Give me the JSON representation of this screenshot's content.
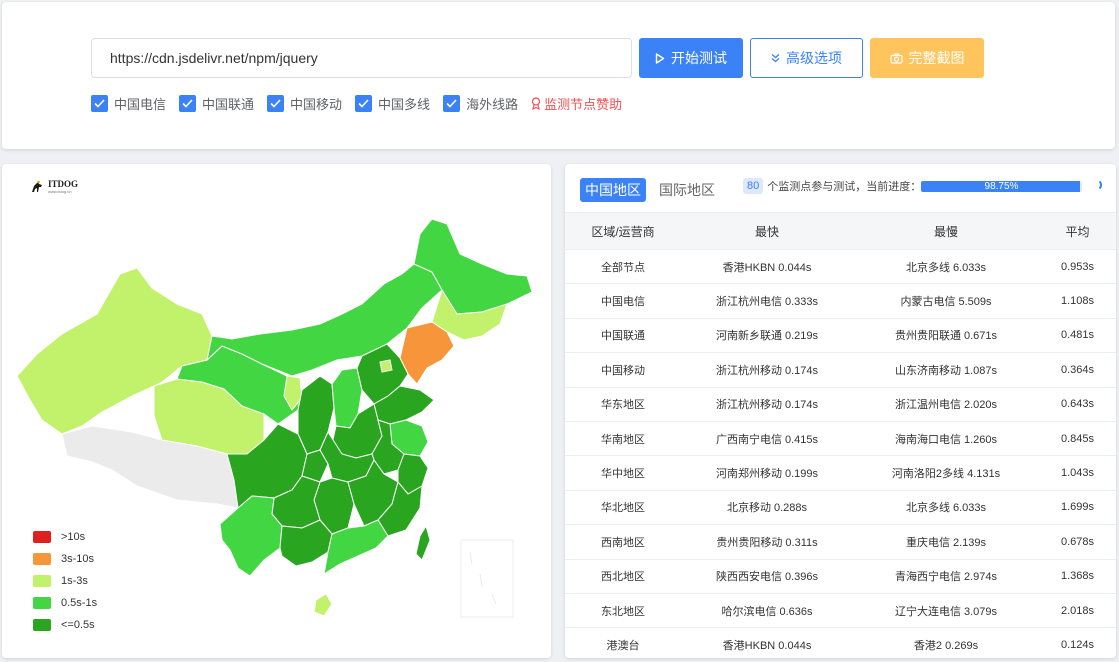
{
  "toolbar": {
    "url_value": "https://cdn.jsdelivr.net/npm/jquery",
    "start_label": "开始测试",
    "advanced_label": "高级选项",
    "screenshot_label": "完整截图"
  },
  "filters": [
    {
      "label": "中国电信",
      "checked": true
    },
    {
      "label": "中国联通",
      "checked": true
    },
    {
      "label": "中国移动",
      "checked": true
    },
    {
      "label": "中国多线",
      "checked": true
    },
    {
      "label": "海外线路",
      "checked": true
    }
  ],
  "sponsor_label": "监测节点赞助",
  "map": {
    "logo_text": "ITDOG",
    "logo_sub": "www.itdog.cn",
    "legend": [
      {
        "label": ">10s",
        "color": "#e02020"
      },
      {
        "label": "3s-10s",
        "color": "#f7953a"
      },
      {
        "label": "1s-3s",
        "color": "#c2f26b"
      },
      {
        "label": "0.5s-1s",
        "color": "#43d643"
      },
      {
        "label": "<=0.5s",
        "color": "#2aa520"
      }
    ]
  },
  "tabs": [
    {
      "label": "中国地区",
      "active": true
    },
    {
      "label": "国际地区",
      "active": false
    }
  ],
  "progress": {
    "count": "80",
    "text": "个监测点参与测试，当前进度：",
    "percent_label": "98.75%",
    "percent": 98.75
  },
  "table": {
    "headers": [
      "区域/运营商",
      "最快",
      "最慢",
      "平均"
    ],
    "rows": [
      [
        "全部节点",
        "香港HKBN 0.044s",
        "北京多线 6.033s",
        "0.953s"
      ],
      [
        "中国电信",
        "浙江杭州电信 0.333s",
        "内蒙古电信 5.509s",
        "1.108s"
      ],
      [
        "中国联通",
        "河南新乡联通 0.219s",
        "贵州贵阳联通 0.671s",
        "0.481s"
      ],
      [
        "中国移动",
        "浙江杭州移动 0.174s",
        "山东济南移动 1.087s",
        "0.364s"
      ],
      [
        "华东地区",
        "浙江杭州移动 0.174s",
        "浙江温州电信 2.020s",
        "0.643s"
      ],
      [
        "华南地区",
        "广西南宁电信 0.415s",
        "海南海口电信 1.260s",
        "0.845s"
      ],
      [
        "华中地区",
        "河南郑州移动 0.199s",
        "河南洛阳2多线 4.131s",
        "1.043s"
      ],
      [
        "华北地区",
        "北京移动 0.288s",
        "北京多线 6.033s",
        "1.699s"
      ],
      [
        "西南地区",
        "贵州贵阳移动 0.311s",
        "重庆电信 2.139s",
        "0.678s"
      ],
      [
        "西北地区",
        "陕西西安电信 0.396s",
        "青海西宁电信 2.974s",
        "1.368s"
      ],
      [
        "东北地区",
        "哈尔滨电信 0.636s",
        "辽宁大连电信 3.079s",
        "2.018s"
      ],
      [
        "港澳台",
        "香港HKBN 0.044s",
        "香港2 0.269s",
        "0.124s"
      ]
    ]
  }
}
